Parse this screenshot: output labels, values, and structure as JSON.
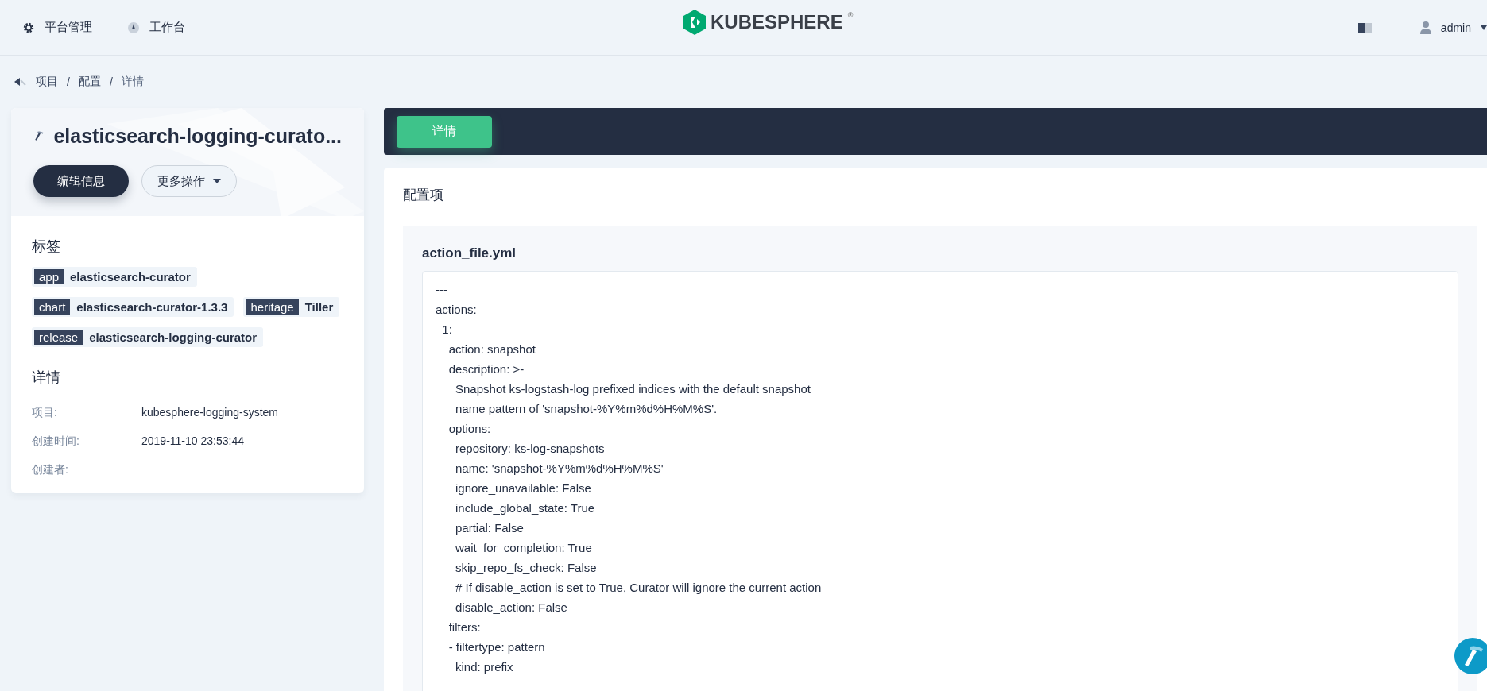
{
  "topbar": {
    "nav": [
      {
        "label": "平台管理",
        "kind": "gear"
      },
      {
        "label": "工作台",
        "kind": "compass"
      }
    ],
    "logo": "KUBESPHERE",
    "logo_mark": "®",
    "user": "admin"
  },
  "breadcrumb": [
    {
      "kind": "link",
      "text": "项目"
    },
    {
      "kind": "separator",
      "text": "/"
    },
    {
      "kind": "link",
      "text": "配置"
    },
    {
      "kind": "separator",
      "text": "/"
    },
    {
      "kind": "current",
      "text": "详情"
    }
  ],
  "resource": {
    "title": "elasticsearch-logging-curato...",
    "buttons": [
      {
        "label": "编辑信息",
        "kind": "primary"
      },
      {
        "label": "更多操作",
        "kind": "dropdown"
      }
    ],
    "labels_title": "标签",
    "labels": [
      {
        "key": "app",
        "value": "elasticsearch-curator"
      },
      {
        "key": "chart",
        "value": "elasticsearch-curator-1.3.3"
      },
      {
        "key": "heritage",
        "value": "Tiller"
      },
      {
        "key": "release",
        "value": "elasticsearch-logging-curator"
      }
    ],
    "details_title": "详情",
    "details": [
      {
        "label": "项目:",
        "value": "kubesphere-logging-system"
      },
      {
        "label": "创建时间:",
        "value": "2019-11-10 23:53:44"
      },
      {
        "label": "创建者:"
      }
    ]
  },
  "tabs": [
    {
      "label": "详情",
      "selected": true
    }
  ],
  "config": {
    "title": "配置项",
    "file": "action_file.yml",
    "lines": [
      "---",
      "actions:",
      "  1:",
      "    action: snapshot",
      "    description: >-",
      "      Snapshot ks-logstash-log prefixed indices with the default snapshot",
      "      name pattern of 'snapshot-%Y%m%d%H%M%S'.",
      "    options:",
      "      repository: ks-log-snapshots",
      "      name: 'snapshot-%Y%m%d%H%M%S'",
      "      ignore_unavailable: False",
      "      include_global_state: True",
      "      partial: False",
      "      wait_for_completion: True",
      "      skip_repo_fs_check: False",
      "      # If disable_action is set to True, Curator will ignore the current action",
      "      disable_action: False",
      "    filters:",
      "    - filtertype: pattern",
      "      kind: prefix"
    ]
  }
}
